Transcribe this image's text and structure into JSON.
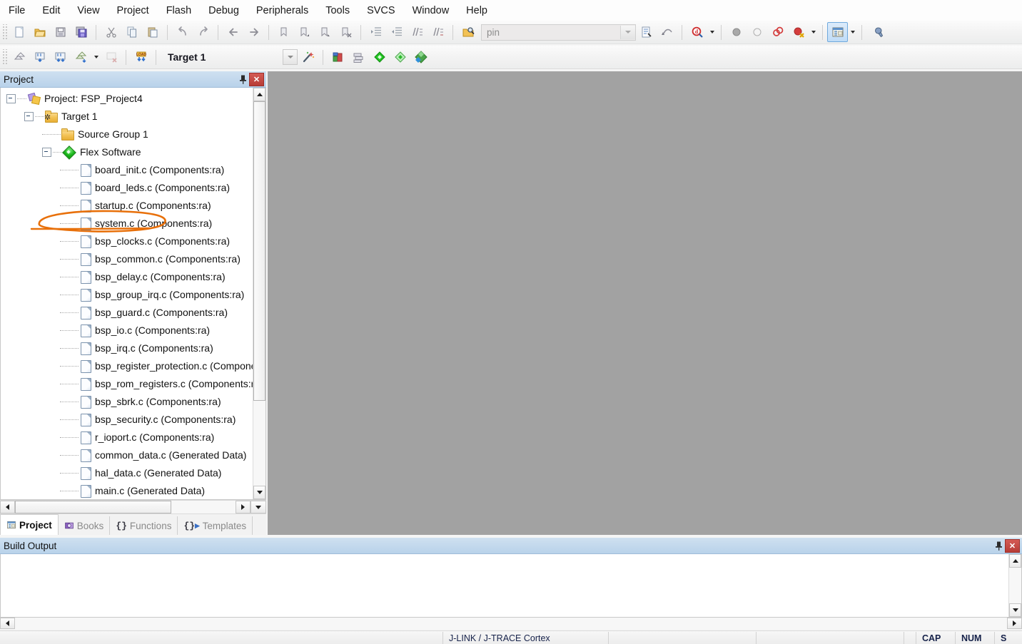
{
  "menu": {
    "items": [
      "File",
      "Edit",
      "View",
      "Project",
      "Flash",
      "Debug",
      "Peripherals",
      "Tools",
      "SVCS",
      "Window",
      "Help"
    ]
  },
  "toolbar_main": {
    "buttons": [
      {
        "name": "new-file-button",
        "icon": "new-file-icon",
        "title": "New"
      },
      {
        "name": "open-file-button",
        "icon": "open-folder-icon",
        "title": "Open"
      },
      {
        "name": "save-button",
        "icon": "save-disk-icon",
        "title": "Save"
      },
      {
        "name": "save-all-button",
        "icon": "save-all-icon",
        "title": "Save All"
      },
      {
        "name": "cut-button",
        "icon": "scissors-icon",
        "title": "Cut"
      },
      {
        "name": "copy-button",
        "icon": "copy-icon",
        "title": "Copy"
      },
      {
        "name": "paste-button",
        "icon": "paste-icon",
        "title": "Paste"
      },
      {
        "name": "undo-button",
        "icon": "undo-arrow-icon",
        "title": "Undo"
      },
      {
        "name": "redo-button",
        "icon": "redo-arrow-icon",
        "title": "Redo"
      },
      {
        "name": "navigate-back-button",
        "icon": "arrow-left-icon",
        "title": "Back"
      },
      {
        "name": "navigate-forward-button",
        "icon": "arrow-right-icon",
        "title": "Forward"
      },
      {
        "name": "bookmark-toggle-button",
        "icon": "bookmark-icon",
        "title": "Toggle Bookmark"
      },
      {
        "name": "bookmark-prev-button",
        "icon": "bookmark-prev-icon",
        "title": "Previous Bookmark"
      },
      {
        "name": "bookmark-next-button",
        "icon": "bookmark-next-icon",
        "title": "Next Bookmark"
      },
      {
        "name": "bookmark-clear-button",
        "icon": "bookmark-clear-icon",
        "title": "Clear Bookmarks"
      },
      {
        "name": "indent-button",
        "icon": "indent-right-icon",
        "title": "Indent"
      },
      {
        "name": "outdent-button",
        "icon": "indent-left-icon",
        "title": "Outdent"
      },
      {
        "name": "comment-button",
        "icon": "comment-lines-icon",
        "title": "Comment"
      },
      {
        "name": "uncomment-button",
        "icon": "uncomment-lines-icon",
        "title": "Uncomment"
      },
      {
        "name": "find-in-files-button",
        "icon": "find-in-files-icon",
        "title": "Find in Files"
      }
    ],
    "search": {
      "value": "pin",
      "placeholder": "pin"
    },
    "after_search": [
      {
        "name": "incremental-find-button",
        "icon": "find-document-icon",
        "title": "Incremental Find"
      },
      {
        "name": "find-next-button",
        "icon": "find-next-icon",
        "title": "Find Next"
      }
    ],
    "browse": [
      {
        "name": "browse-symbol-button",
        "icon": "browse-magnifier-icon",
        "title": "Browse Symbol"
      }
    ],
    "breakpoints": [
      {
        "name": "insert-breakpoint-button",
        "icon": "breakpoint-filled-icon",
        "title": "Insert/Remove Breakpoint"
      },
      {
        "name": "disable-breakpoint-button",
        "icon": "breakpoint-hollow-icon",
        "title": "Enable/Disable Breakpoint"
      },
      {
        "name": "disable-all-breakpoints-button",
        "icon": "breakpoints-rings-icon",
        "title": "Disable All Breakpoints"
      },
      {
        "name": "kill-all-breakpoints-button",
        "icon": "breakpoint-kill-icon",
        "title": "Kill All Breakpoints"
      }
    ],
    "windows": [
      {
        "name": "project-window-toggle",
        "icon": "project-window-icon",
        "title": "Project Window",
        "active": true
      },
      {
        "name": "configuration-wizard-button",
        "icon": "wrench-icon",
        "title": "Configure"
      }
    ]
  },
  "toolbar_build": {
    "buttons": [
      {
        "name": "translate-file-button",
        "icon": "translate-icon",
        "title": "Translate Current File"
      },
      {
        "name": "build-target-button",
        "icon": "build-icon",
        "title": "Build"
      },
      {
        "name": "rebuild-all-button",
        "icon": "rebuild-all-icon",
        "title": "Rebuild All Target Files"
      },
      {
        "name": "batch-build-button",
        "icon": "batch-build-icon",
        "title": "Batch Build"
      },
      {
        "name": "stop-build-button",
        "icon": "stop-build-icon",
        "title": "Stop Build"
      },
      {
        "name": "download-button",
        "icon": "load-download-icon",
        "title": "Download"
      }
    ],
    "target": {
      "value": "Target 1"
    },
    "after_target": [
      {
        "name": "target-options-button",
        "icon": "magic-wand-icon",
        "title": "Options for Target"
      },
      {
        "name": "manage-project-items-button",
        "icon": "manage-components-icon",
        "title": "Manage Project Items"
      },
      {
        "name": "multi-project-button",
        "icon": "multi-project-icon",
        "title": "Multi-Project"
      },
      {
        "name": "pack-installer-button",
        "icon": "green-diamond-icon",
        "title": "Pack Installer"
      },
      {
        "name": "manage-run-time-button",
        "icon": "run-time-environment-icon",
        "title": "Manage Run-Time Environment"
      },
      {
        "name": "software-packs-button",
        "icon": "software-packs-icon",
        "title": "Select Software Packs"
      }
    ]
  },
  "project_panel": {
    "title": "Project",
    "pin_icon": "pin-icon",
    "close_icon": "close-icon",
    "tree": [
      {
        "label": "Project: FSP_Project4",
        "depth": 0,
        "icon": "project-icon",
        "expander": true
      },
      {
        "label": "Target 1",
        "depth": 1,
        "icon": "target-folder-icon",
        "expander": true
      },
      {
        "label": "Source Group 1",
        "depth": 2,
        "icon": "folder-icon",
        "expander": false,
        "annotated": true
      },
      {
        "label": "Flex Software",
        "depth": 2,
        "icon": "flex-software-icon",
        "expander": true
      },
      {
        "label": "board_init.c (Components:ra)",
        "depth": 3,
        "icon": "c-file-icon",
        "expander": false
      },
      {
        "label": "board_leds.c (Components:ra)",
        "depth": 3,
        "icon": "c-file-icon",
        "expander": false
      },
      {
        "label": "startup.c (Components:ra)",
        "depth": 3,
        "icon": "c-file-icon",
        "expander": false
      },
      {
        "label": "system.c (Components:ra)",
        "depth": 3,
        "icon": "c-file-icon",
        "expander": false
      },
      {
        "label": "bsp_clocks.c (Components:ra)",
        "depth": 3,
        "icon": "c-file-icon",
        "expander": false
      },
      {
        "label": "bsp_common.c (Components:ra)",
        "depth": 3,
        "icon": "c-file-icon",
        "expander": false
      },
      {
        "label": "bsp_delay.c (Components:ra)",
        "depth": 3,
        "icon": "c-file-icon",
        "expander": false
      },
      {
        "label": "bsp_group_irq.c (Components:ra)",
        "depth": 3,
        "icon": "c-file-icon",
        "expander": false
      },
      {
        "label": "bsp_guard.c (Components:ra)",
        "depth": 3,
        "icon": "c-file-icon",
        "expander": false
      },
      {
        "label": "bsp_io.c (Components:ra)",
        "depth": 3,
        "icon": "c-file-icon",
        "expander": false
      },
      {
        "label": "bsp_irq.c (Components:ra)",
        "depth": 3,
        "icon": "c-file-icon",
        "expander": false
      },
      {
        "label": "bsp_register_protection.c (Components:ra)",
        "depth": 3,
        "icon": "c-file-icon",
        "expander": false
      },
      {
        "label": "bsp_rom_registers.c (Components:ra)",
        "depth": 3,
        "icon": "c-file-icon",
        "expander": false
      },
      {
        "label": "bsp_sbrk.c (Components:ra)",
        "depth": 3,
        "icon": "c-file-icon",
        "expander": false
      },
      {
        "label": "bsp_security.c (Components:ra)",
        "depth": 3,
        "icon": "c-file-icon",
        "expander": false
      },
      {
        "label": "r_ioport.c (Components:ra)",
        "depth": 3,
        "icon": "c-file-icon",
        "expander": false
      },
      {
        "label": "common_data.c (Generated Data)",
        "depth": 3,
        "icon": "c-file-icon",
        "expander": false
      },
      {
        "label": "hal_data.c (Generated Data)",
        "depth": 3,
        "icon": "c-file-icon",
        "expander": false
      },
      {
        "label": "main.c (Generated Data)",
        "depth": 3,
        "icon": "c-file-icon",
        "expander": false
      }
    ],
    "annotation": {
      "shape": "ellipse",
      "color": "#E8700A",
      "target_label": "Source Group 1"
    },
    "tabs": [
      {
        "label": "Project",
        "icon": "project-window-icon",
        "selected": true
      },
      {
        "label": "Books",
        "icon": "books-icon",
        "selected": false
      },
      {
        "label": "Functions",
        "icon": "braces-icon",
        "selected": false
      },
      {
        "label": "Templates",
        "icon": "templates-icon",
        "selected": false
      }
    ]
  },
  "build_output": {
    "title": "Build Output",
    "pin_icon": "pin-icon",
    "close_icon": "close-icon",
    "content": ""
  },
  "statusbar": {
    "cells": [
      "",
      "J-LINK / J-TRACE Cortex",
      "",
      "",
      ""
    ],
    "indicators": [
      "CAP",
      "NUM",
      "S"
    ]
  },
  "colors": {
    "annotation": "#E8700A",
    "panel_title": "#b9d2ea",
    "mdi_background": "#a2a2a2",
    "close_button": "#b73c36"
  }
}
